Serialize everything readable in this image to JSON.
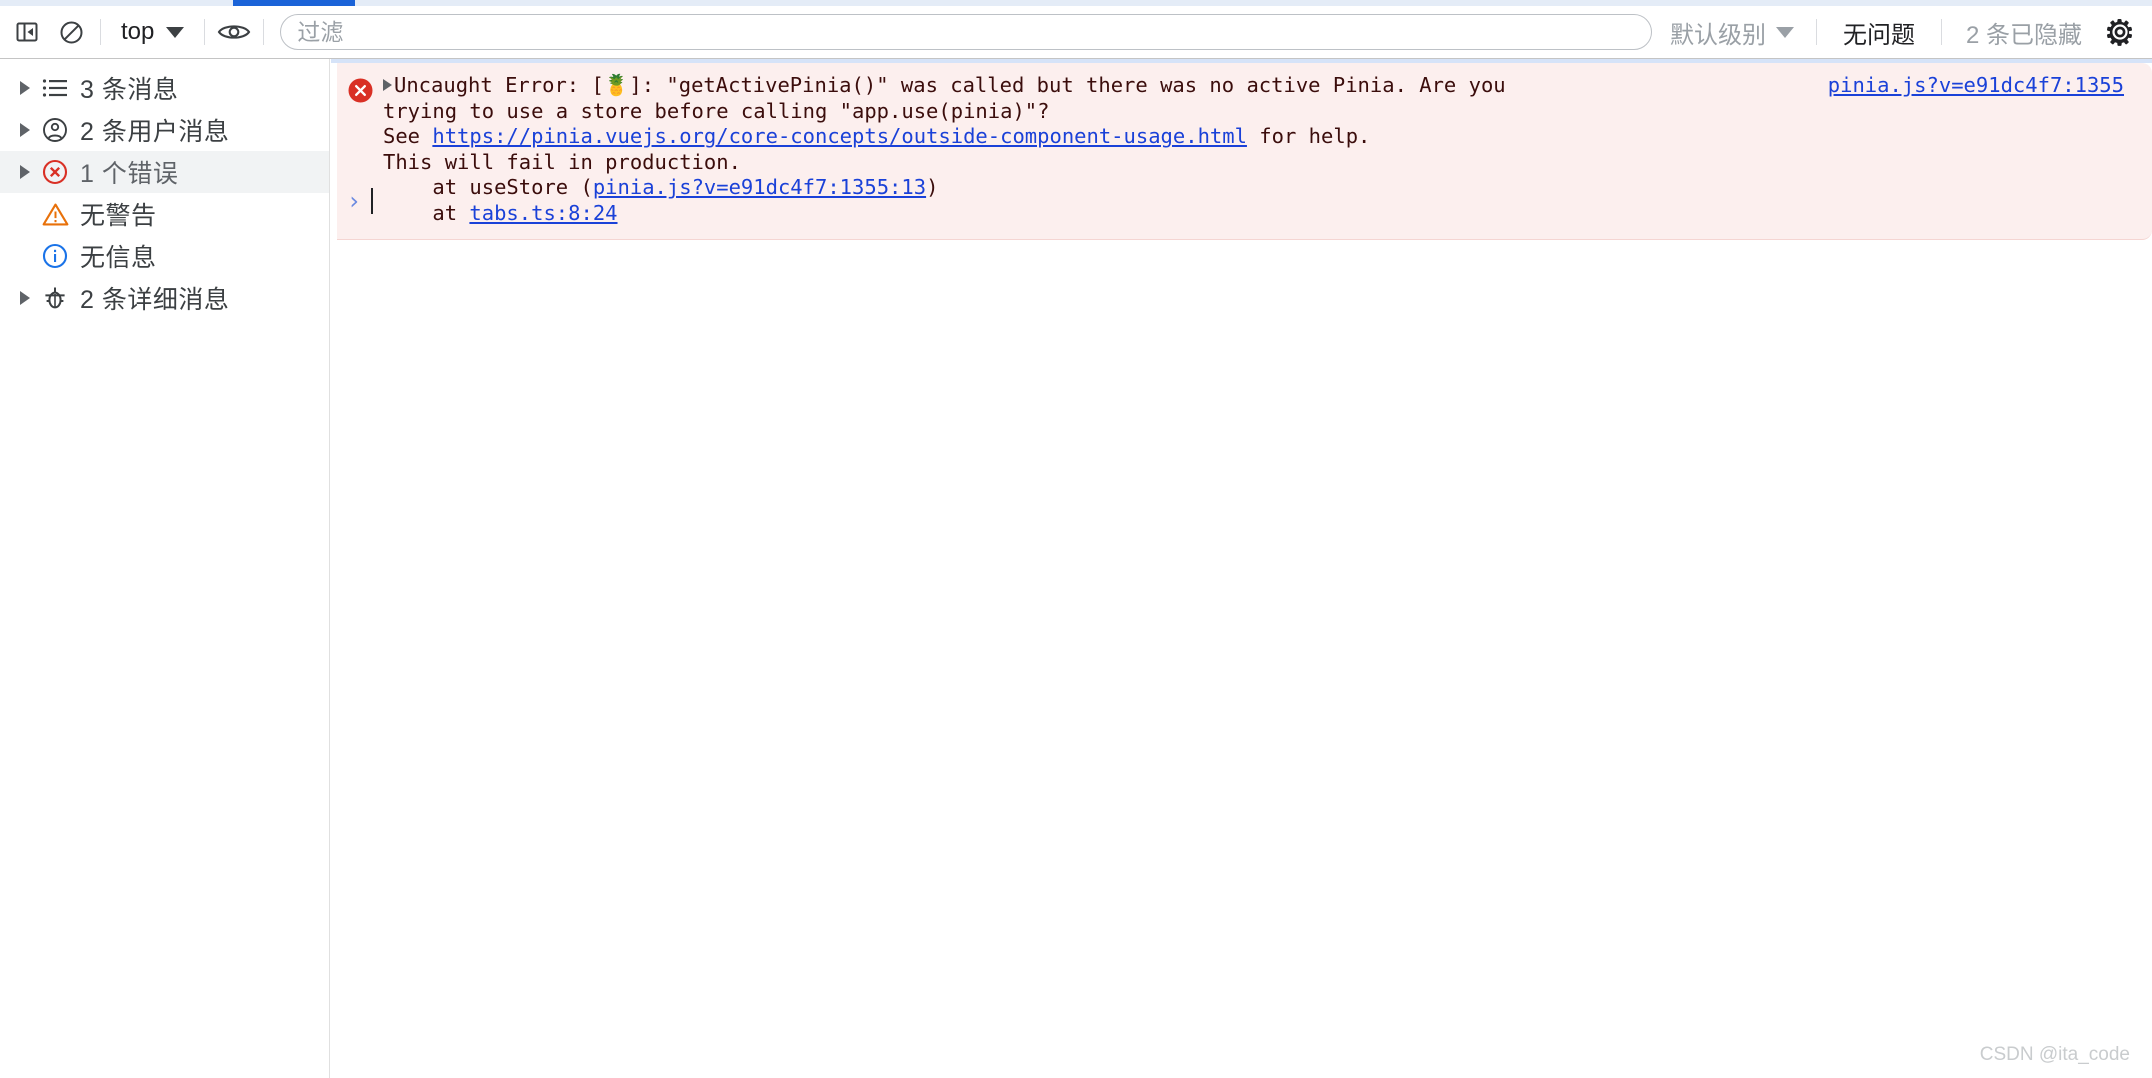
{
  "toolbar": {
    "sidebar_toggle_icon": "sidebar-panel-icon",
    "clear_console_icon": "clear-console-icon",
    "context_label": "top",
    "context_caret_icon": "chevron-down-icon",
    "live_expression_icon": "eye-icon",
    "filter_placeholder": "过滤",
    "filter_value": "",
    "level_label": "默认级别",
    "level_caret_icon": "chevron-down-icon",
    "issues_label": "无问题",
    "hidden_label": "2 条已隐藏",
    "settings_icon": "gear-icon"
  },
  "sidebar": {
    "items": [
      {
        "label": "3 条消息",
        "icon": "list-icon",
        "expandable": true,
        "selected": false
      },
      {
        "label": "2 条用户消息",
        "icon": "user-circle-icon",
        "expandable": true,
        "selected": false
      },
      {
        "label": "1 个错误",
        "icon": "error-circle-icon",
        "expandable": true,
        "selected": true
      },
      {
        "label": "无警告",
        "icon": "warning-triangle-icon",
        "expandable": false,
        "selected": false
      },
      {
        "label": "无信息",
        "icon": "info-circle-icon",
        "expandable": false,
        "selected": false
      },
      {
        "label": "2 条详细消息",
        "icon": "bug-icon",
        "expandable": true,
        "selected": false
      }
    ]
  },
  "console": {
    "error": {
      "badge_icon": "error-circle-icon",
      "expand_icon": "disclosure-triangle-icon",
      "line1_a": "Uncaught Error: [",
      "emoji": "🍍",
      "line1_b": "]: \"getActivePinia()\" was called but there was no active Pinia. Are you",
      "line2": "trying to use a store before calling \"app.use(pinia)\"?",
      "line3_prefix": "See ",
      "line3_link": "https://pinia.vuejs.org/core-concepts/outside-component-usage.html",
      "line3_suffix": " for help.",
      "line4": "This will fail in production.",
      "line5_prefix": "    at useStore (",
      "line5_link": "pinia.js?v=e91dc4f7:1355:13",
      "line5_suffix": ")",
      "line6_prefix": "    at ",
      "line6_link": "tabs.ts:8:24",
      "source_link": "pinia.js?v=e91dc4f7:1355"
    },
    "prompt": {
      "arrow": "›",
      "input_value": ""
    }
  },
  "watermark": "CSDN @ita_code",
  "colors": {
    "accent_blue": "#1a63d8",
    "error_bg": "#fcefee",
    "error_red": "#d93025",
    "link_blue": "#1a41d8",
    "warning_orange": "#e8710a",
    "info_blue": "#1a73e8"
  }
}
